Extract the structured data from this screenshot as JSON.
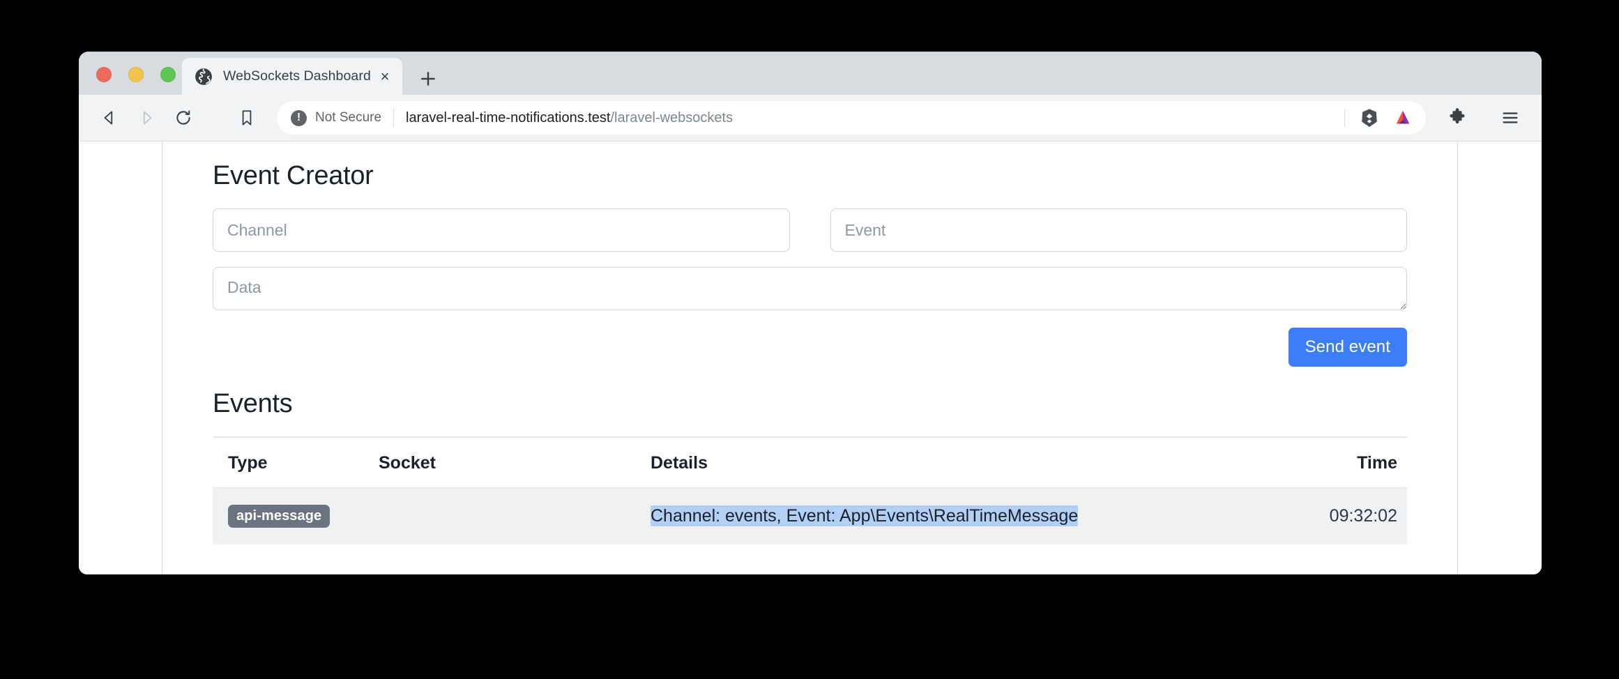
{
  "browser": {
    "window_controls": [
      {
        "name": "close",
        "color": "#ec6a5e"
      },
      {
        "name": "minimize",
        "color": "#f3c34e"
      },
      {
        "name": "maximize",
        "color": "#61c554"
      }
    ],
    "tab": {
      "title": "WebSockets Dashboard",
      "favicon": "globe-icon",
      "close_label": "×"
    },
    "new_tab_label": "+",
    "nav": {
      "back_icon": "back-arrow-icon",
      "forward_icon": "forward-arrow-icon",
      "reload_icon": "reload-icon",
      "bookmark_icon": "bookmark-icon"
    },
    "omnibox": {
      "security_badge": "Not Secure",
      "security_icon": "warning-circle-icon",
      "url_host": "laravel-real-time-notifications.test",
      "url_path": "/laravel-websockets",
      "brave_shields_icon": "brave-lion-icon",
      "bat_icon": "bat-triangle-icon"
    },
    "toolbar_right": {
      "extensions_icon": "puzzle-piece-icon",
      "menu_icon": "hamburger-menu-icon"
    }
  },
  "page": {
    "event_creator": {
      "heading": "Event Creator",
      "channel_placeholder": "Channel",
      "channel_value": "",
      "event_placeholder": "Event",
      "event_value": "",
      "data_placeholder": "Data",
      "data_value": "",
      "send_button_label": "Send event",
      "send_button_color": "#3b7ef7"
    },
    "events": {
      "heading": "Events",
      "columns": [
        "Type",
        "Socket",
        "Details",
        "Time"
      ],
      "rows": [
        {
          "type": "api-message",
          "type_badge_color": "#6b7280",
          "socket": "",
          "details": "Channel: events, Event: App\\Events\\RealTimeMessage",
          "details_selected": true,
          "time": "09:32:02"
        }
      ]
    }
  }
}
